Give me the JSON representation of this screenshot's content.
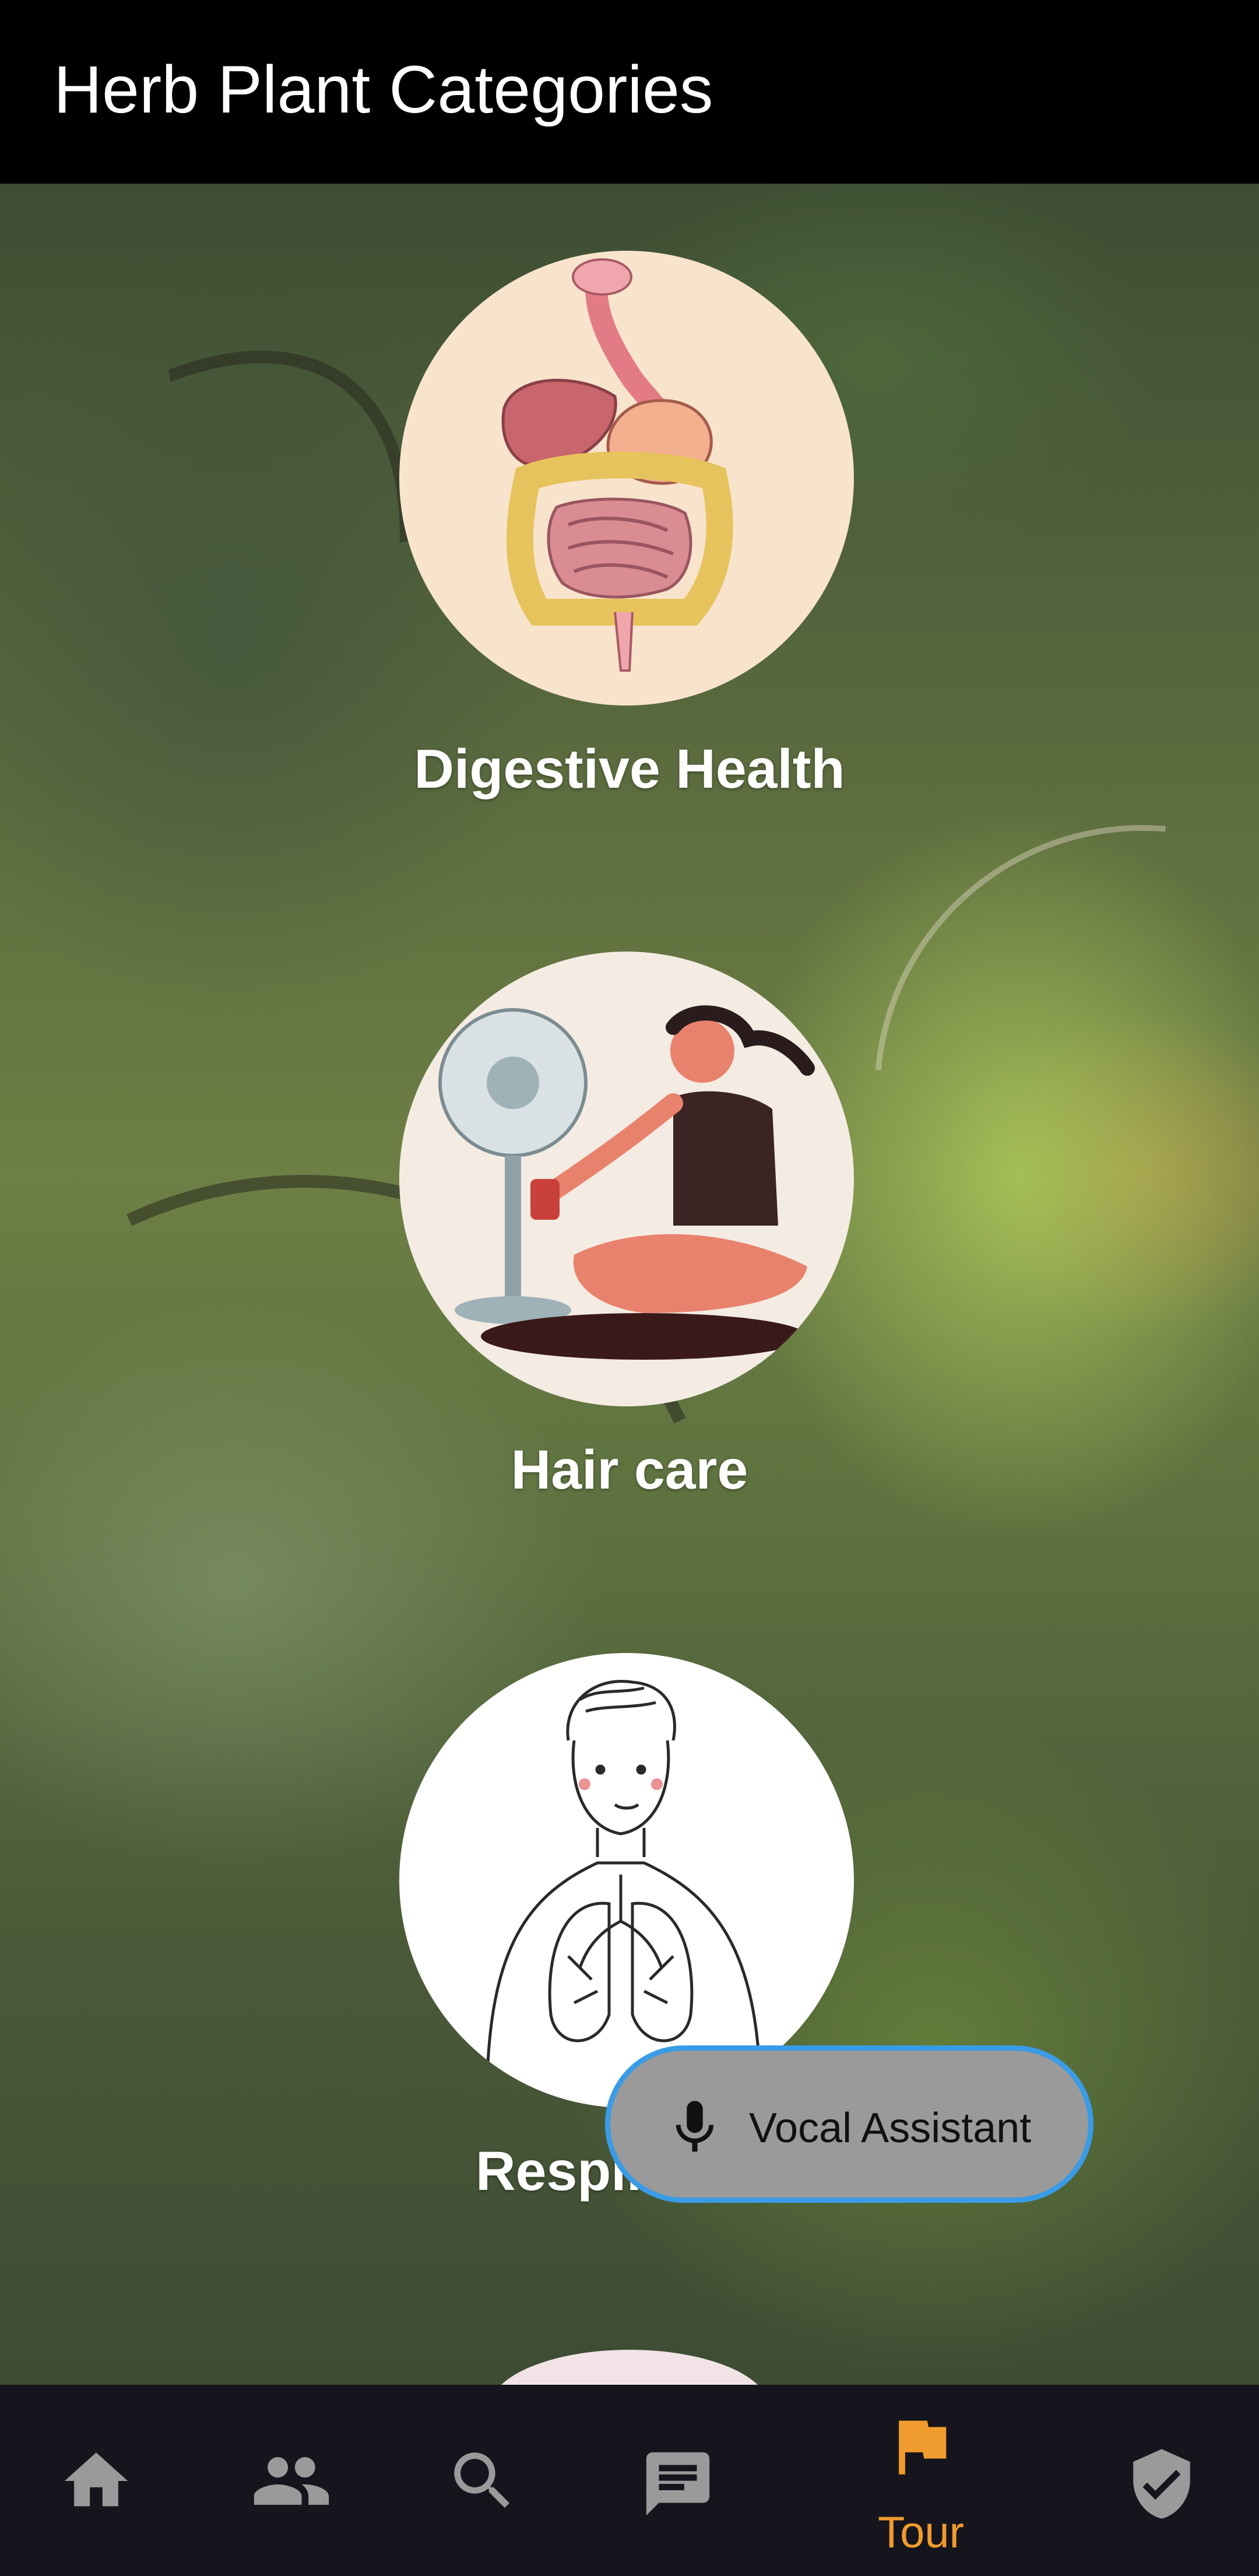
{
  "app_bar": {
    "title": "Herb Plant Categories"
  },
  "categories": [
    {
      "label": "Digestive Health",
      "image": "digestive-system-illustration"
    },
    {
      "label": "Hair care",
      "image": "woman-with-fan-illustration"
    },
    {
      "label": "Respiratory",
      "image": "man-lungs-sketch-illustration"
    }
  ],
  "vocal_assistant": {
    "label": "Vocal Assistant",
    "icon": "microphone-icon"
  },
  "bottom_nav": {
    "items": [
      {
        "icon": "home-icon",
        "label": ""
      },
      {
        "icon": "people-icon",
        "label": ""
      },
      {
        "icon": "search-icon",
        "label": ""
      },
      {
        "icon": "chat-icon",
        "label": ""
      },
      {
        "icon": "flag-icon",
        "label": "Tour",
        "active": true
      },
      {
        "icon": "shield-check-icon",
        "label": ""
      }
    ],
    "active_color": "#f09b2d",
    "inactive_color": "#9a9a9a"
  },
  "colors": {
    "app_bar_bg": "#000000",
    "nav_bg": "#16151d",
    "fab_bg": "#9a9a9a",
    "fab_border": "#3a9be6"
  }
}
